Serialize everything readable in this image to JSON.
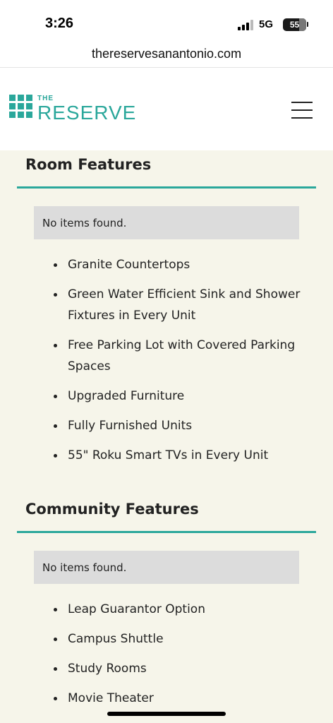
{
  "status_bar": {
    "time": "3:26",
    "network": "5G",
    "battery": "55"
  },
  "browser": {
    "url": "thereservesanantonio.com"
  },
  "header": {
    "logo_small": "THE",
    "logo_main": "RESERVE",
    "menu_icon": "hamburger-menu-icon"
  },
  "room_features": {
    "title": "Room Features",
    "empty_message": "No items found.",
    "items": [
      "Granite Countertops",
      "Green Water Efficient Sink and Shower Fixtures in Every Unit",
      "Free Parking Lot with Covered Parking Spaces",
      "Upgraded Furniture",
      "Fully Furnished Units",
      "55\" Roku Smart TVs in Every Unit"
    ]
  },
  "community_features": {
    "title": "Community Features",
    "empty_message": "No items found.",
    "items": [
      "Leap Guarantor Option",
      "Campus Shuttle",
      "Study Rooms",
      "Movie Theater"
    ]
  },
  "colors": {
    "accent": "#2aa79b",
    "background": "#f6f5ea",
    "empty_box": "#dcdcdc"
  }
}
